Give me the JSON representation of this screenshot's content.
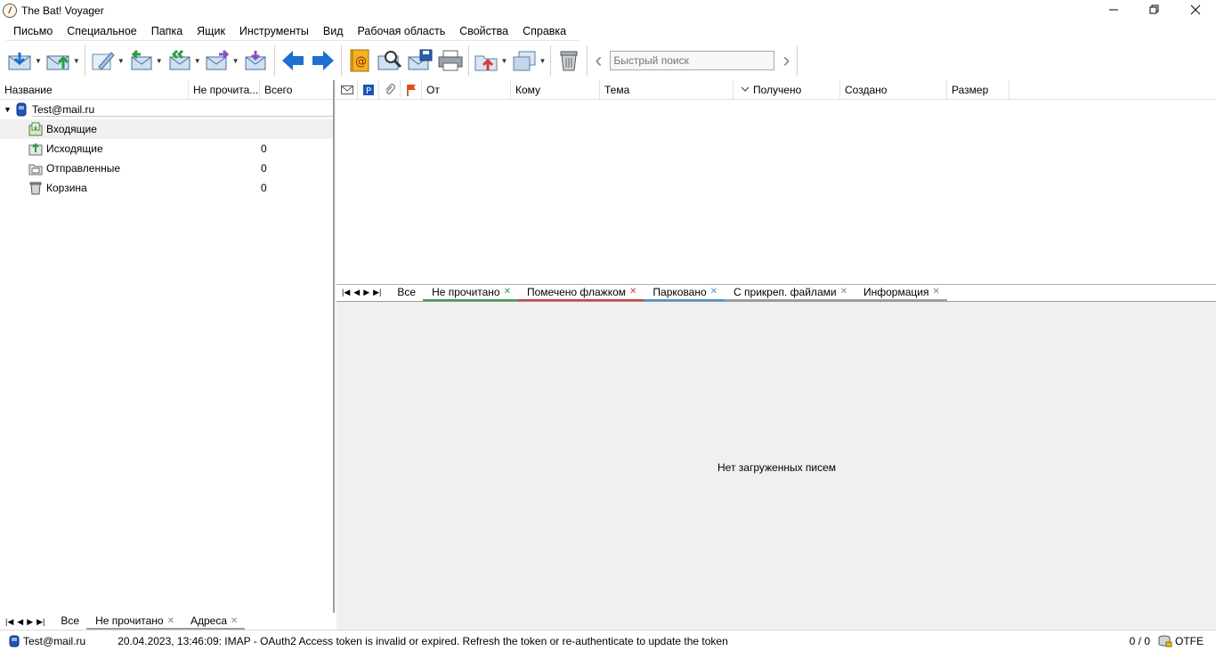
{
  "window": {
    "title": "The Bat! Voyager",
    "icon": "the-bat-icon"
  },
  "menu": [
    "Письмо",
    "Специальное",
    "Папка",
    "Ящик",
    "Инструменты",
    "Вид",
    "Рабочая область",
    "Свойства",
    "Справка"
  ],
  "toolbar": {
    "search_placeholder": "Быстрый поиск",
    "icons": [
      "get-mail-icon",
      "send-mail-icon",
      "new-message-icon",
      "reply-icon",
      "reply-all-icon",
      "forward-icon",
      "redirect-icon",
      "prev-message-icon",
      "next-message-icon",
      "address-book-icon",
      "find-icon",
      "save-message-icon",
      "print-icon",
      "move-to-folder-icon",
      "copy-to-folder-icon",
      "delete-icon",
      "search-back-icon",
      "search-forward-icon"
    ]
  },
  "folders": {
    "columns": [
      "Название",
      "Не прочита...",
      "Всего"
    ],
    "account": "Test@mail.ru",
    "items": [
      {
        "name": "Входящие",
        "count": "",
        "icon": "inbox-icon"
      },
      {
        "name": "Исходящие",
        "count": "0",
        "icon": "outbox-icon"
      },
      {
        "name": "Отправленные",
        "count": "0",
        "icon": "sent-icon"
      },
      {
        "name": "Корзина",
        "count": "0",
        "icon": "trash-icon"
      }
    ],
    "tabs": [
      "Все",
      "Не прочитано",
      "Адреса"
    ]
  },
  "messages": {
    "columns": [
      "От",
      "Кому",
      "Тема",
      "Получено",
      "Создано",
      "Размер"
    ],
    "tabs": [
      "Все",
      "Не прочитано",
      "Помечено флажком",
      "Парковано",
      "С прикреп. файлами",
      "Информация"
    ],
    "empty_text": "Нет загруженных писем"
  },
  "status": {
    "account": "Test@mail.ru",
    "message": "20.04.2023, 13:46:09: IMAP  - OAuth2 Access token is invalid or expired. Refresh the token or re-authenticate to update the token",
    "counter": "0 / 0",
    "encoding": "OTFE"
  },
  "colors": {
    "accent_blue": "#1d6fd1",
    "tab_unread": "#3f9b4e",
    "tab_flagged": "#d43b3b",
    "tab_parked": "#4a90d9",
    "tab_attach": "#9c9c9c",
    "tab_info": "#9c9c9c"
  }
}
